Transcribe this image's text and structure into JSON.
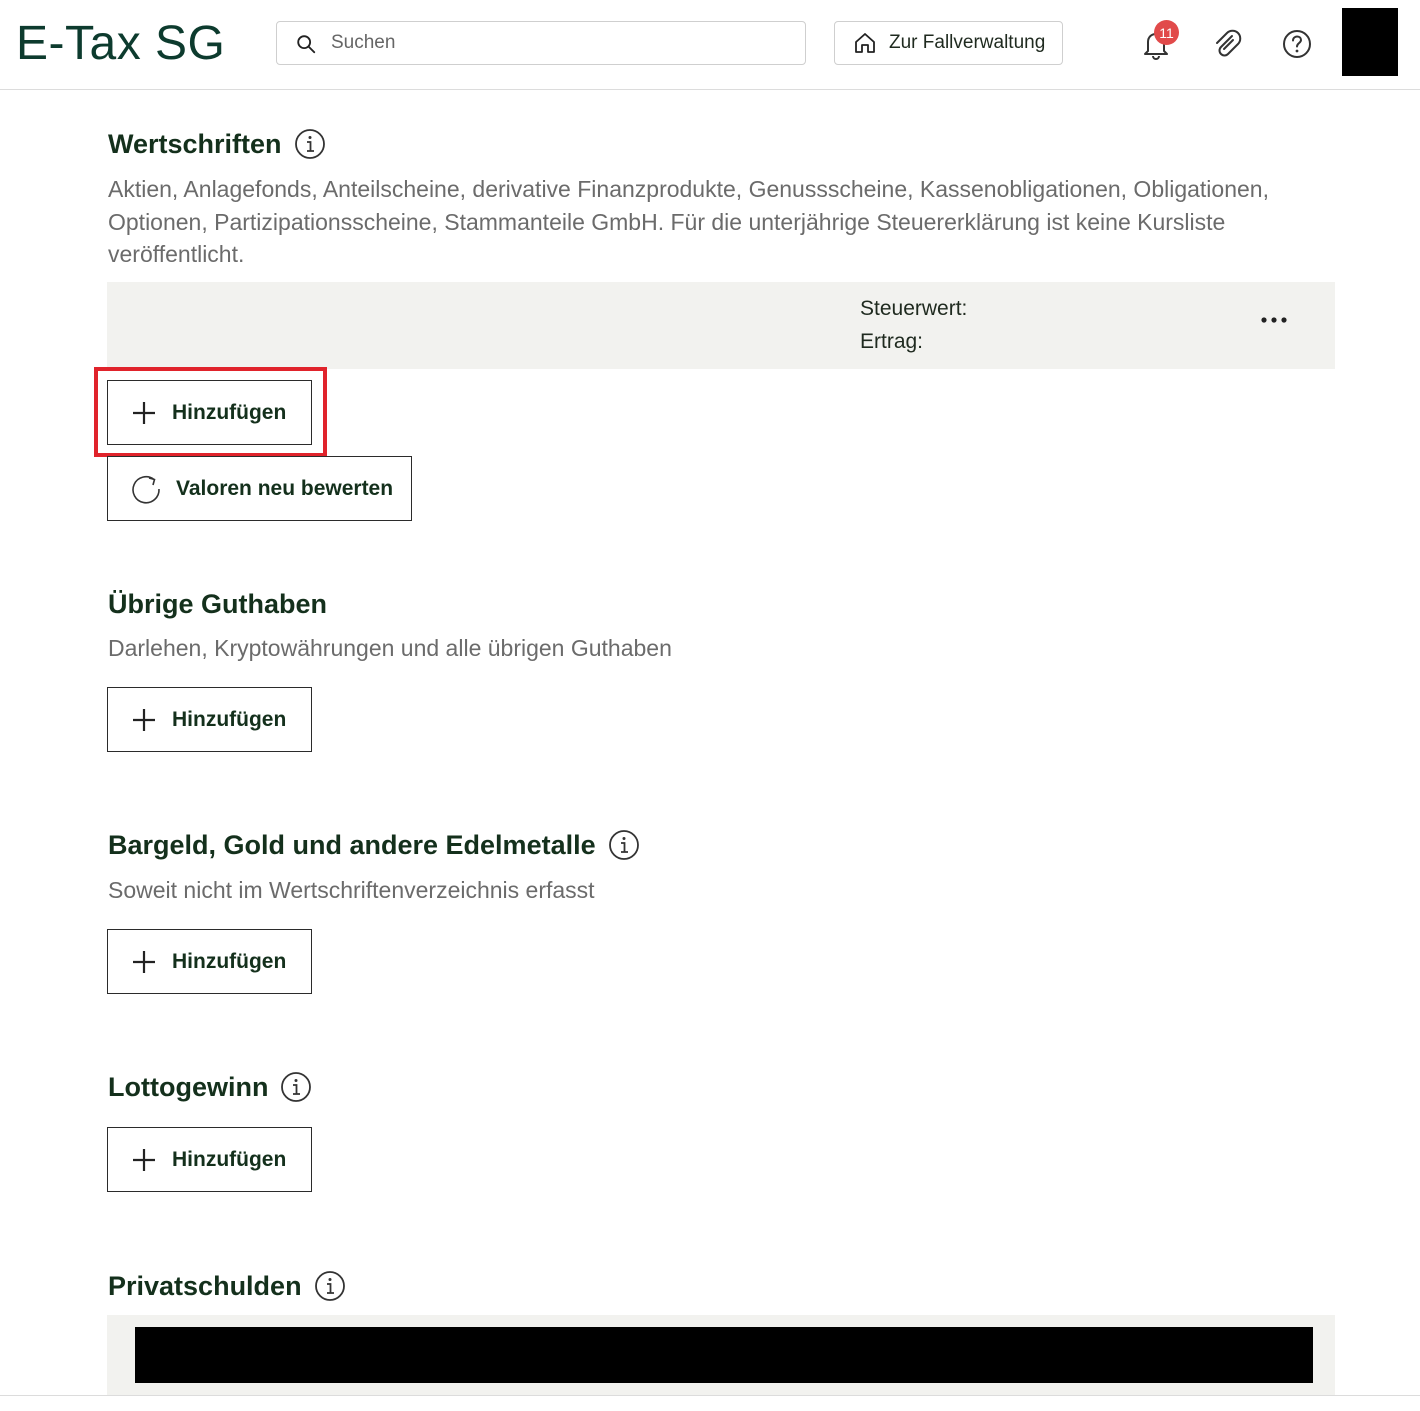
{
  "header": {
    "logo": "E-Tax SG",
    "search": {
      "placeholder": "Suchen"
    },
    "case_button": "Zur Fallverwaltung",
    "notifications_count": "11"
  },
  "sections": {
    "wertschriften": {
      "title": "Wertschriften",
      "description": "Aktien, Anlagefonds, Anteilscheine, derivative Finanzprodukte, Genussscheine, Kassenobligationen, Obligationen, Optionen, Partizipationsscheine, Stammanteile GmbH. Für die unterjährige Steuererklärung ist keine Kursliste veröffentlicht.",
      "summary": {
        "steuerwert_label": "Steuerwert:",
        "ertrag_label": "Ertrag:"
      },
      "add_button": "Hinzufügen",
      "revalue_button": "Valoren neu bewerten"
    },
    "uebrige_guthaben": {
      "title": "Übrige Guthaben",
      "description": "Darlehen, Kryptowährungen und alle übrigen Guthaben",
      "add_button": "Hinzufügen"
    },
    "bargeld": {
      "title": "Bargeld, Gold und andere Edelmetalle",
      "description": "Soweit nicht im Wertschriftenverzeichnis erfasst",
      "add_button": "Hinzufügen"
    },
    "lottogewinn": {
      "title": "Lottogewinn",
      "add_button": "Hinzufügen"
    },
    "privatschulden": {
      "title": "Privatschulden"
    }
  },
  "colors": {
    "accent_green": "#14301c",
    "highlight_red": "#e0232b",
    "badge_red": "#e14a4a"
  }
}
